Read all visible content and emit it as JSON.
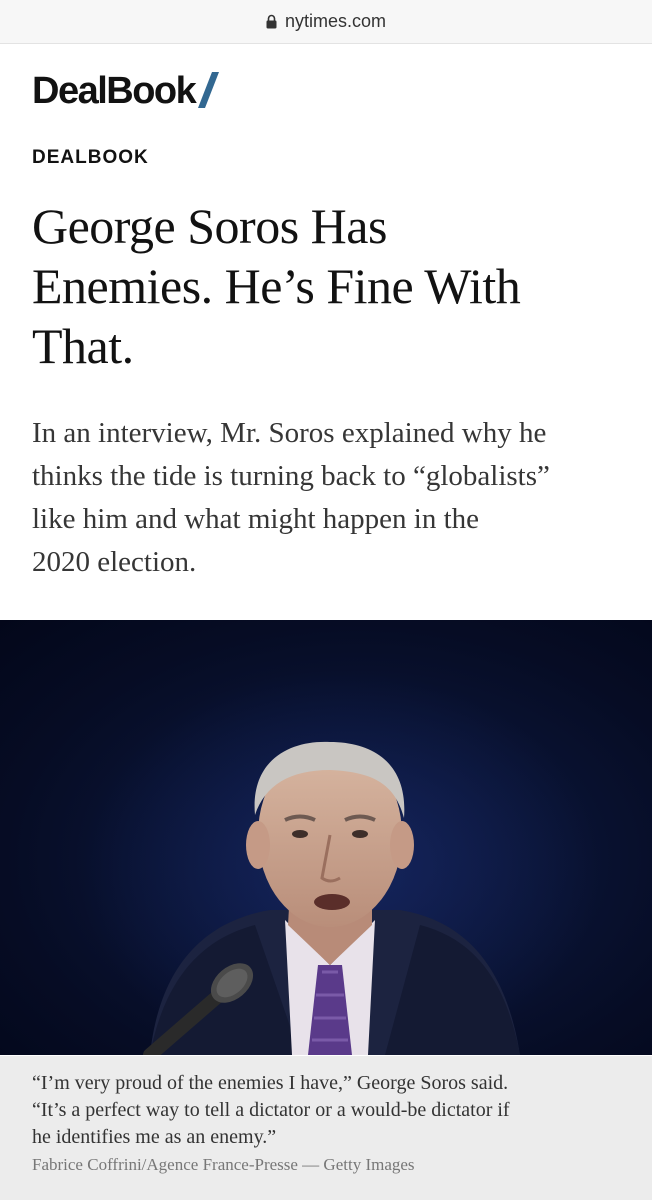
{
  "browser": {
    "url": "nytimes.com",
    "lock_icon": "lock-icon"
  },
  "masthead": {
    "logo_text": "DealBook",
    "accent_color": "#326891"
  },
  "article": {
    "kicker": "DEALBOOK",
    "headline_lines": [
      "George Soros Has",
      "Enemies. He’s Fine With",
      "That."
    ],
    "summary_lines": [
      "In an interview, Mr. Soros explained why he",
      "thinks the tide is turning back to “globalists”",
      "like him and what might happen in the",
      "2020 election."
    ]
  },
  "photo": {
    "caption_lines": [
      "“I’m very proud of the enemies I have,” George Soros said.",
      "“It’s a perfect way to tell a dictator or a would-be dictator if",
      "he identifies me as an enemy.”"
    ],
    "credit": "Fabrice Coffrini/Agence France-Presse — Getty Images"
  }
}
